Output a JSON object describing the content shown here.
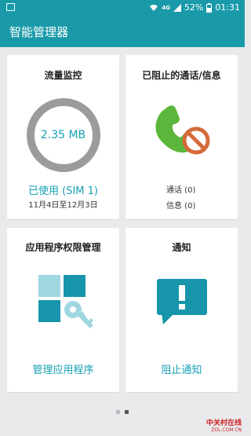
{
  "status_bar": {
    "battery": "52%",
    "time": "01:31",
    "network": "4G"
  },
  "app": {
    "title": "智能管理器"
  },
  "cards": {
    "data_monitor": {
      "title": "流量监控",
      "usage": "2.35 MB",
      "used_label": "已使用 (SIM 1)",
      "period": "11月4日至12月3日"
    },
    "blocked": {
      "title": "已阻止的通话/信息",
      "calls": "通话 (0)",
      "messages": "信息 (0)"
    },
    "permissions": {
      "title": "应用程序权限管理",
      "action": "管理应用程序"
    },
    "notifications": {
      "title": "通知",
      "action": "阻止通知"
    }
  },
  "pager": {
    "pages": 2,
    "active": 2
  },
  "watermark": {
    "line1": "中关村在线",
    "line2": "ZOL.COM.CN"
  },
  "colors": {
    "accent": "#1a9aa9",
    "teal_text": "#16a0b4",
    "phone_green": "#5bb63b",
    "block_orange": "#d56a3a"
  }
}
